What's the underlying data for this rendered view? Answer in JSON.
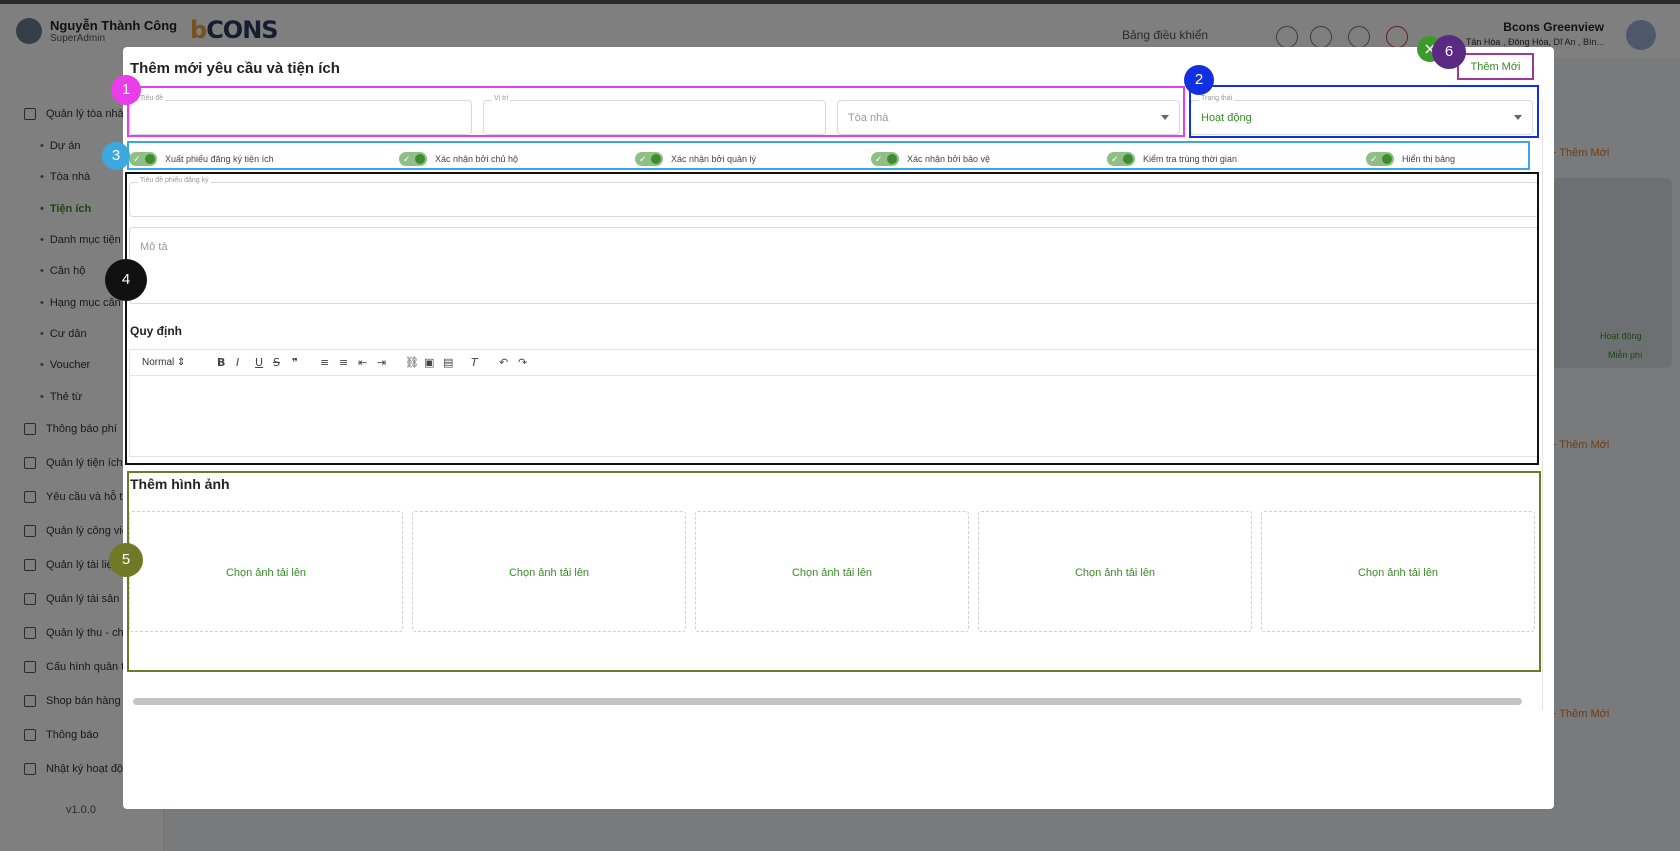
{
  "topbar": {
    "user_name": "Nguyễn Thành Công",
    "user_role": "SuperAdmin",
    "logo_text": "CONS",
    "dashboard_label": "Bảng điều khiển",
    "org_name": "Bcons Greenview",
    "org_address": "Tân Hòa , Đông Hòa, Dĩ An , Bìn..."
  },
  "sidebar": {
    "items": [
      {
        "label": "Quản lý tòa nhà"
      },
      {
        "label": "Dự án"
      },
      {
        "label": "Tòa nhà"
      },
      {
        "label": "Tiện ích"
      },
      {
        "label": "Danh mục tiện ích"
      },
      {
        "label": "Căn hộ"
      },
      {
        "label": "Hạng mục căn hộ"
      },
      {
        "label": "Cư dân"
      },
      {
        "label": "Voucher"
      },
      {
        "label": "Thẻ từ"
      },
      {
        "label": "Thông báo phí"
      },
      {
        "label": "Quản lý tiện ích"
      },
      {
        "label": "Yêu cầu và hỗ trợ"
      },
      {
        "label": "Quản lý công việc"
      },
      {
        "label": "Quản lý tài liệu"
      },
      {
        "label": "Quản lý tài sản"
      },
      {
        "label": "Quản lý thu - chi"
      },
      {
        "label": "Cấu hình quản trị"
      },
      {
        "label": "Shop bán hàng"
      },
      {
        "label": "Thông báo"
      },
      {
        "label": "Nhật ký hoạt động"
      }
    ],
    "version": "v1.0.0"
  },
  "background": {
    "add_label": "+ Thêm Mới",
    "status_active": "Hoạt động",
    "status_free": "Miễn phí"
  },
  "modal": {
    "title": "Thêm mới yêu cầu và tiện ích",
    "add_button": "Thêm Mới",
    "close_icon": "×",
    "fields": {
      "title_label": "Tiêu đề",
      "location_label": "Vị trí",
      "building_placeholder": "Tòa nhà",
      "status_label": "Trạng thái",
      "status_value": "Hoạt động",
      "form_title_label": "Tiêu đề phiếu đăng ký",
      "description_placeholder": "Mô tả"
    },
    "toggles": [
      {
        "label": "Xuất phiếu đăng ký tiện ích"
      },
      {
        "label": "Xác nhận bởi chủ hộ"
      },
      {
        "label": "Xác nhận bởi quản lý"
      },
      {
        "label": "Xác nhận bởi bảo vệ"
      },
      {
        "label": "Kiểm tra trùng thời gian"
      },
      {
        "label": "Hiển thị bảng"
      }
    ],
    "rules_label": "Quy định",
    "editor": {
      "format_select": "Normal"
    },
    "images_label": "Thêm hình ảnh",
    "upload_label": "Chọn ảnh tải lên"
  },
  "annotations": {
    "badges": [
      "1",
      "2",
      "3",
      "4",
      "5",
      "6"
    ],
    "colors": {
      "1": "#e93de9",
      "2": "#1230e0",
      "3": "#3ba9e0",
      "4": "#111111",
      "5": "#6e7a26",
      "6": "#5a2a82"
    }
  }
}
